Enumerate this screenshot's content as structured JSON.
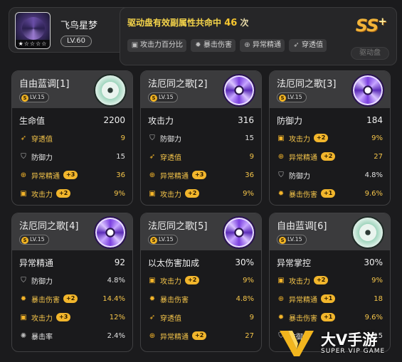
{
  "agent": {
    "name": "飞鸟星梦",
    "level": "LV.60",
    "rank_stars": "★☆☆☆☆"
  },
  "summary": {
    "title_prefix": "驱动盘有效副属性共命中",
    "count": "46",
    "unit": "次",
    "tags": [
      {
        "icon": "attack-percent-icon",
        "label": "攻击力百分比"
      },
      {
        "icon": "crit-damage-icon",
        "label": "暴击伤害"
      },
      {
        "icon": "anomaly-mastery-icon",
        "label": "异常精通"
      },
      {
        "icon": "pen-ratio-icon",
        "label": "穿透值"
      }
    ],
    "rank": "SS",
    "rank_plus": "+",
    "drive_disc_button": "驱动盘"
  },
  "cards": [
    {
      "name": "自由蓝调[1]",
      "level": "LV.15",
      "disc": "green",
      "main": {
        "label": "生命值",
        "value": "2200"
      },
      "subs": [
        {
          "label": "穿透值",
          "icon": "pen-icon",
          "value": "9",
          "plus": "",
          "hl": true
        },
        {
          "label": "防御力",
          "icon": "shield-icon",
          "value": "15",
          "plus": "",
          "hl": false
        },
        {
          "label": "异常精通",
          "icon": "anomaly-icon",
          "value": "36",
          "plus": "+3",
          "hl": true
        },
        {
          "label": "攻击力",
          "icon": "fist-icon",
          "value": "9%",
          "plus": "+2",
          "hl": true
        }
      ]
    },
    {
      "name": "法厄同之歌[2]",
      "level": "LV.15",
      "disc": "purple",
      "main": {
        "label": "攻击力",
        "value": "316"
      },
      "subs": [
        {
          "label": "防御力",
          "icon": "shield-icon",
          "value": "15",
          "plus": "",
          "hl": false
        },
        {
          "label": "穿透值",
          "icon": "pen-icon",
          "value": "9",
          "plus": "",
          "hl": true
        },
        {
          "label": "异常精通",
          "icon": "anomaly-icon",
          "value": "36",
          "plus": "+3",
          "hl": true
        },
        {
          "label": "攻击力",
          "icon": "fist-icon",
          "value": "9%",
          "plus": "+2",
          "hl": true
        }
      ]
    },
    {
      "name": "法厄同之歌[3]",
      "level": "LV.15",
      "disc": "purple",
      "main": {
        "label": "防御力",
        "value": "184"
      },
      "subs": [
        {
          "label": "攻击力",
          "icon": "fist-icon",
          "value": "9%",
          "plus": "+2",
          "hl": true
        },
        {
          "label": "异常精通",
          "icon": "anomaly-icon",
          "value": "27",
          "plus": "+2",
          "hl": true
        },
        {
          "label": "防御力",
          "icon": "shield-icon",
          "value": "4.8%",
          "plus": "",
          "hl": false
        },
        {
          "label": "暴击伤害",
          "icon": "crit-icon",
          "value": "9.6%",
          "plus": "+1",
          "hl": true
        }
      ]
    },
    {
      "name": "法厄同之歌[4]",
      "level": "LV.15",
      "disc": "purple",
      "main": {
        "label": "异常精通",
        "value": "92"
      },
      "subs": [
        {
          "label": "防御力",
          "icon": "shield-icon",
          "value": "4.8%",
          "plus": "",
          "hl": false
        },
        {
          "label": "暴击伤害",
          "icon": "crit-icon",
          "value": "14.4%",
          "plus": "+2",
          "hl": true
        },
        {
          "label": "攻击力",
          "icon": "fist-icon",
          "value": "12%",
          "plus": "+3",
          "hl": true
        },
        {
          "label": "暴击率",
          "icon": "crit-rate-icon",
          "value": "2.4%",
          "plus": "",
          "hl": false
        }
      ]
    },
    {
      "name": "法厄同之歌[5]",
      "level": "LV.15",
      "disc": "purple",
      "main": {
        "label": "以太伤害加成",
        "value": "30%"
      },
      "subs": [
        {
          "label": "攻击力",
          "icon": "fist-icon",
          "value": "9%",
          "plus": "+2",
          "hl": true
        },
        {
          "label": "暴击伤害",
          "icon": "crit-icon",
          "value": "4.8%",
          "plus": "",
          "hl": true
        },
        {
          "label": "穿透值",
          "icon": "pen-icon",
          "value": "9",
          "plus": "",
          "hl": true
        },
        {
          "label": "异常精通",
          "icon": "anomaly-icon",
          "value": "27",
          "plus": "+2",
          "hl": true
        }
      ]
    },
    {
      "name": "自由蓝调[6]",
      "level": "LV.15",
      "disc": "green",
      "main": {
        "label": "异常掌控",
        "value": "30%"
      },
      "subs": [
        {
          "label": "攻击力",
          "icon": "fist-icon",
          "value": "9%",
          "plus": "+2",
          "hl": true
        },
        {
          "label": "异常精通",
          "icon": "anomaly-icon",
          "value": "18",
          "plus": "+1",
          "hl": true
        },
        {
          "label": "暴击伤害",
          "icon": "crit-icon",
          "value": "9.6%",
          "plus": "+1",
          "hl": true
        },
        {
          "label": "防御力",
          "icon": "shield-icon",
          "value": "15",
          "plus": "",
          "hl": false
        }
      ]
    }
  ],
  "watermark": {
    "brand": "大V手游",
    "tagline": "SUPER VIP GAME"
  }
}
